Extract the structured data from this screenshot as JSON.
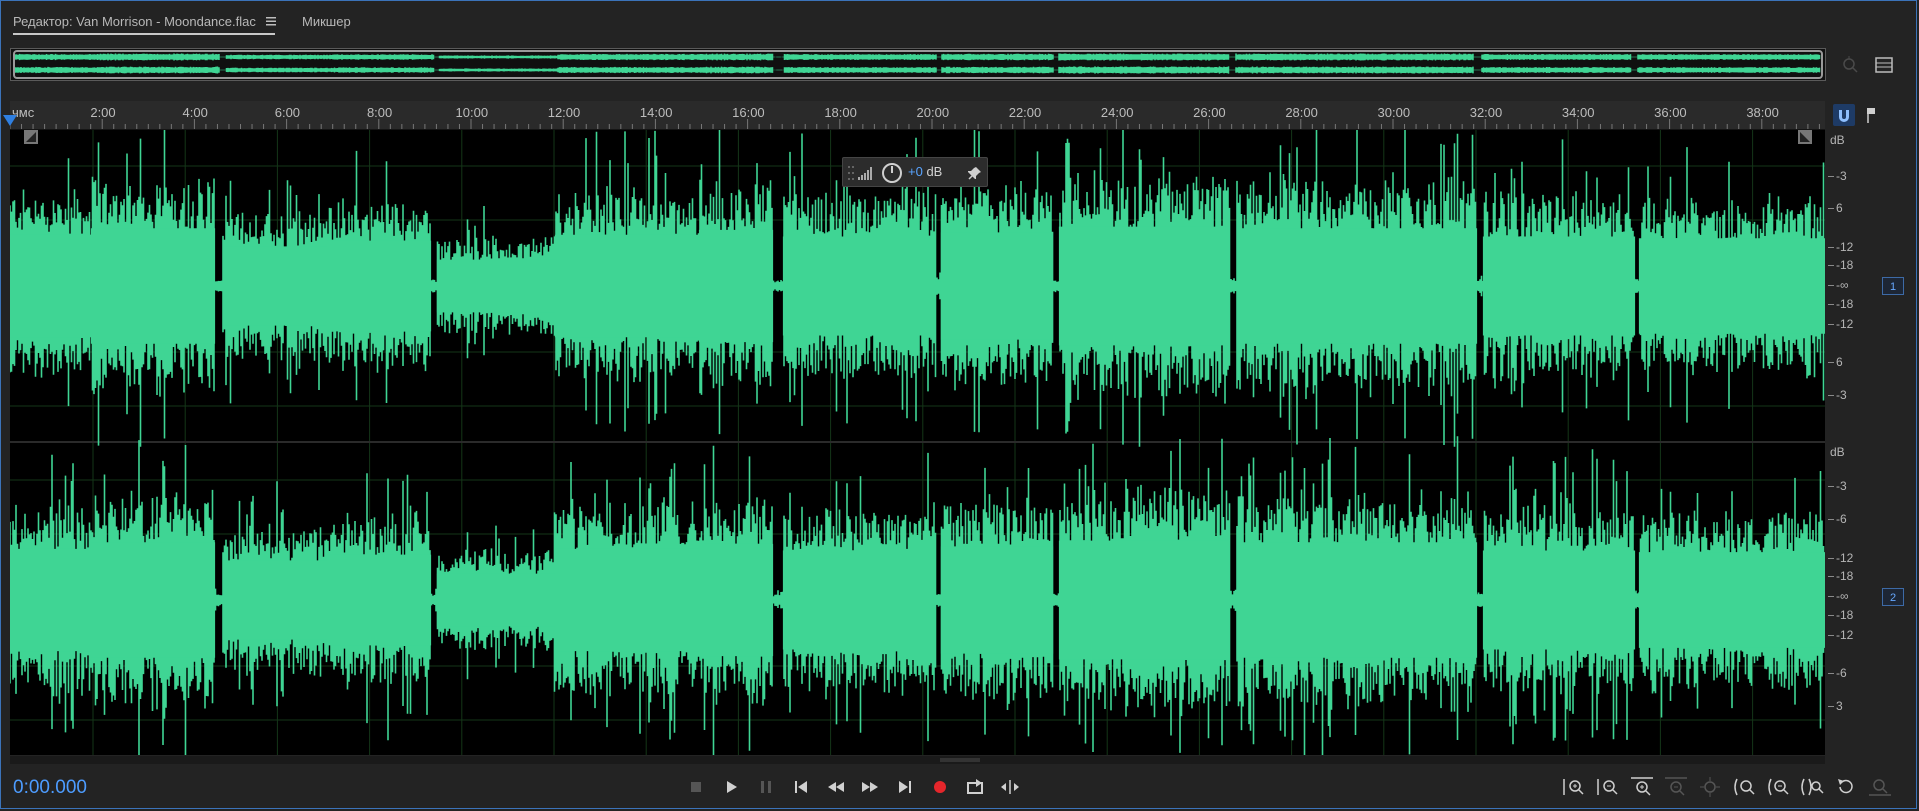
{
  "tabs": {
    "editor_label": "Редактор: Van Morrison - Moondance.flac",
    "mixer_label": "Микшер"
  },
  "ruler": {
    "unit": "чмс",
    "labels": [
      "2:00",
      "4:00",
      "6:00",
      "8:00",
      "10:00",
      "12:00",
      "14:00",
      "16:00",
      "18:00",
      "20:00",
      "22:00",
      "24:00",
      "26:00",
      "28:00",
      "30:00",
      "32:00",
      "34:00",
      "36:00",
      "38:00"
    ]
  },
  "hud": {
    "value": "+0",
    "unit": "dB"
  },
  "db_scale": {
    "unit": "dB",
    "channel1_labels": [
      "-3",
      "6",
      "-12",
      "-18",
      "-∞",
      "-18",
      "-12",
      "6",
      "-3"
    ],
    "channel2_labels": [
      "-3",
      "-6",
      "-12",
      "-18",
      "-∞",
      "-18",
      "-12",
      "-6",
      "3"
    ]
  },
  "channels": {
    "ch1": "1",
    "ch2": "2"
  },
  "status": {
    "timecode": "0:00.000"
  },
  "colors": {
    "waveform": "#3fd594",
    "accent": "#4d9cff",
    "record": "#e5262b"
  },
  "icons": {
    "transport": [
      "stop-icon",
      "play-icon",
      "pause-icon",
      "skip-start-icon",
      "rewind-icon",
      "fast-forward-icon",
      "skip-end-icon",
      "record-icon",
      "loop-icon",
      "skip-selection-icon"
    ],
    "zoom": [
      "zoom-in-amplitude-icon",
      "zoom-out-amplitude-icon",
      "zoom-in-time-icon",
      "zoom-out-time-icon",
      "zoom-fit-icon",
      "zoom-in-left-icon",
      "zoom-in-right-icon",
      "zoom-selection-icon",
      "zoom-reset-icon",
      "zoom-full-icon"
    ]
  }
}
